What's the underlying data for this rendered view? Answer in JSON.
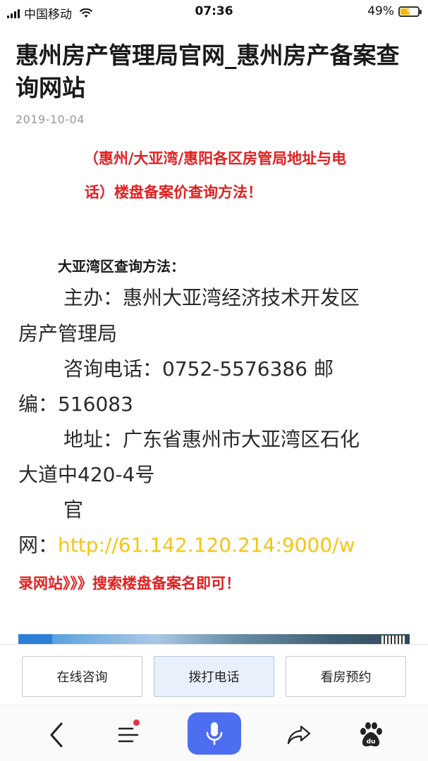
{
  "status_bar": {
    "carrier": "中国移动",
    "time": "07:36",
    "battery": "49%",
    "battery_level": 0.49
  },
  "article": {
    "title": "惠州房产管理局官网_惠州房产备案查询网站",
    "date": "2019-10-04",
    "red_note_line1": "（惠州/大亚湾/惠阳各区房管局地址与电",
    "red_note_line2": "话）楼盘备案价查询方法！",
    "section_heading": "大亚湾区查询方法：",
    "lines": [
      "主办：惠州大亚湾经济技术开发区",
      "房产管理局",
      "咨询电话：0752-5576386 邮",
      "编：516083",
      "地址：广东省惠州市大亚湾区石化",
      "大道中420-4号",
      "官",
      "网："
    ],
    "link_text": "http://61.142.120.214:9000/w",
    "red_tail": "录网站》》》搜索楼盘备案名即可！"
  },
  "action_bar": {
    "consult_label": "在线咨询",
    "call_label": "拨打电话",
    "booking_label": "看房预约"
  },
  "bottom_nav": {
    "icons": [
      "back-icon",
      "menu-icon",
      "microphone-icon",
      "share-icon",
      "baidu-paw-icon"
    ]
  },
  "colors": {
    "accent_red": "#e02020",
    "link_yellow": "#f5c518",
    "voice_blue": "#4e6ef2",
    "battery_yellow": "#f5b400"
  }
}
